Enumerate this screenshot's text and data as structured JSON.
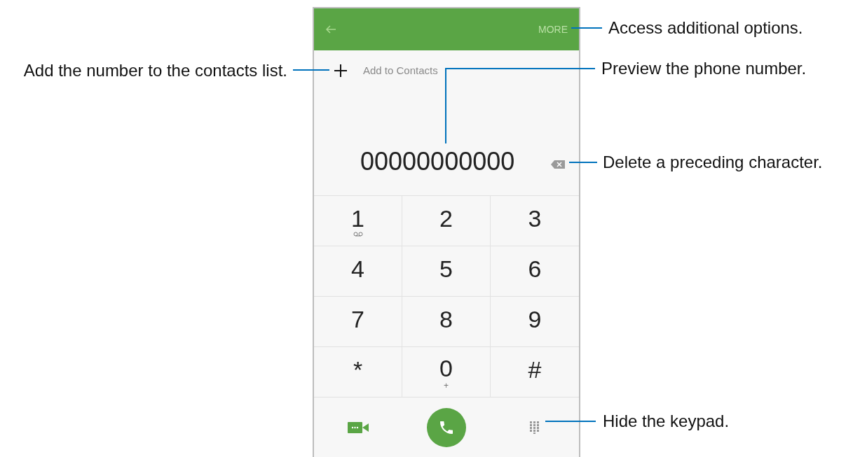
{
  "phone": {
    "header": {
      "more": "MORE"
    },
    "add_contacts": "Add to Contacts",
    "number": "00000000000",
    "keys": [
      {
        "digit": "1",
        "kind": "voicemail"
      },
      {
        "digit": "2",
        "kind": "plain"
      },
      {
        "digit": "3",
        "kind": "plain"
      },
      {
        "digit": "4",
        "kind": "plain"
      },
      {
        "digit": "5",
        "kind": "plain"
      },
      {
        "digit": "6",
        "kind": "plain"
      },
      {
        "digit": "7",
        "kind": "plain"
      },
      {
        "digit": "8",
        "kind": "plain"
      },
      {
        "digit": "9",
        "kind": "plain"
      },
      {
        "digit": "*",
        "kind": "plain"
      },
      {
        "digit": "0",
        "kind": "sub",
        "sub": "+"
      },
      {
        "digit": "#",
        "kind": "plain"
      }
    ]
  },
  "callouts": {
    "add": "Add the number to the contacts list.",
    "more": "Access additional options.",
    "preview": "Preview the phone number.",
    "delete": "Delete a preceding character.",
    "keypad": "Hide the keypad."
  }
}
